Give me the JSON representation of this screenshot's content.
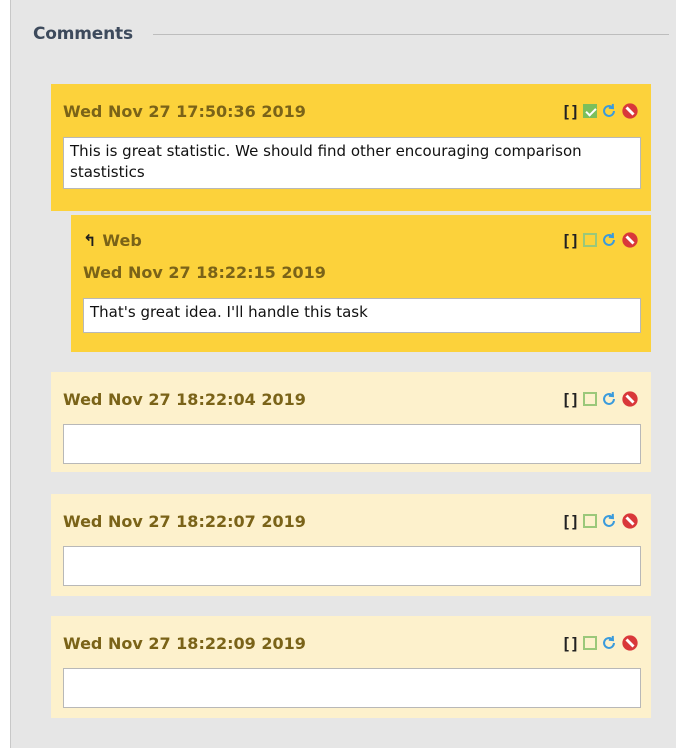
{
  "section": {
    "title": "Comments"
  },
  "comments": [
    {
      "date": "Wed Nov 27 17:50:36 2019",
      "text": "This is great statistic. We should find other encouraging comparison stastistics",
      "checked": true
    },
    {
      "author": "Web",
      "date": "Wed Nov 27 18:22:15 2019",
      "text": "That's great idea. I'll handle this task",
      "checked": false
    },
    {
      "date": "Wed Nov 27 18:22:04 2019",
      "text": "",
      "checked": false
    },
    {
      "date": "Wed Nov 27 18:22:07 2019",
      "text": "",
      "checked": false
    },
    {
      "date": "Wed Nov 27 18:22:09 2019",
      "text": "",
      "checked": false
    }
  ],
  "tools": {
    "bracket_label": "[]"
  },
  "icons": [
    "bracket-icon",
    "checkbox-icon",
    "refresh-icon",
    "delete-icon",
    "reply-arrow-icon"
  ],
  "colors": {
    "active_bg": "#fcd23b",
    "inactive_bg": "#fdf1cc",
    "date_text": "#7a6318",
    "title_text": "#3d4a5c",
    "refresh": "#3a9bdc",
    "delete": "#d9383a",
    "check_green": "#7cbf5c"
  }
}
